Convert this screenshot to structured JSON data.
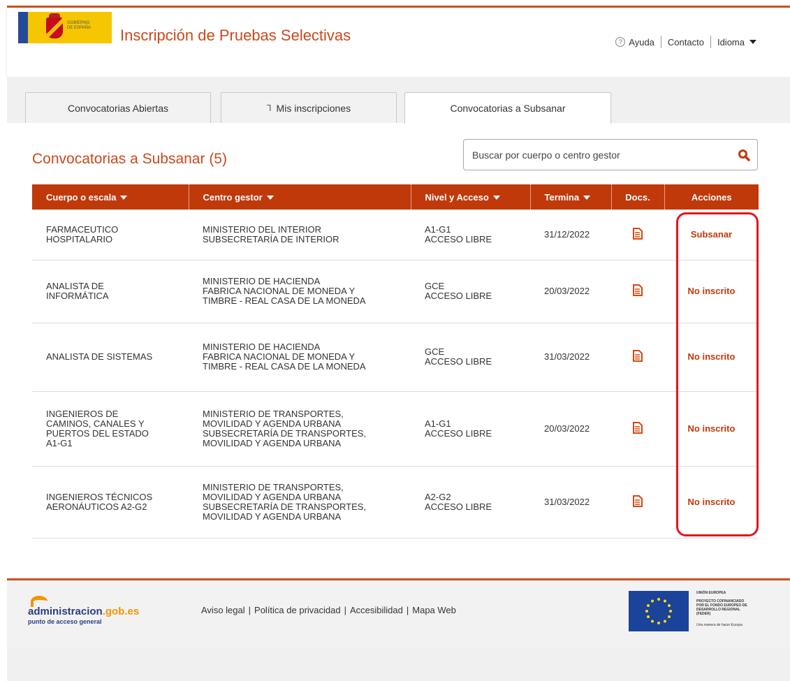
{
  "header": {
    "gov_logo_text": [
      "GOBIERNO",
      "DE ESPAÑA"
    ],
    "title": "Inscripción de Pruebas Selectivas",
    "help": "Ayuda",
    "contact": "Contacto",
    "language": "Idioma"
  },
  "tabs": [
    {
      "label": "Convocatorias Abiertas",
      "active": false
    },
    {
      "label": "Mis inscripciones",
      "active": false,
      "icon": "lock-icon"
    },
    {
      "label": "Convocatorias a Subsanar",
      "active": true
    }
  ],
  "main": {
    "title": "Convocatorias a Subsanar (5)",
    "search_placeholder": "Buscar por cuerpo o centro gestor"
  },
  "table": {
    "headers": {
      "cuerpo": "Cuerpo o escala",
      "centro": "Centro gestor",
      "nivel": "Nivel y Acceso",
      "termina": "Termina",
      "docs": "Docs.",
      "acciones": "Acciones"
    },
    "rows": [
      {
        "cuerpo": [
          "FARMACEUTICO",
          "HOSPITALARIO"
        ],
        "centro": [
          "MINISTERIO DEL INTERIOR",
          "SUBSECRETARÍA DE INTERIOR"
        ],
        "nivel": [
          "A1-G1",
          "ACCESO LIBRE"
        ],
        "termina": "31/12/2022",
        "action": "Subsanar"
      },
      {
        "cuerpo": [
          "ANALISTA DE",
          "INFORMÁTICA"
        ],
        "centro": [
          "MINISTERIO DE HACIENDA",
          "FABRICA NACIONAL DE MONEDA Y",
          "TIMBRE - REAL CASA DE LA MONEDA"
        ],
        "nivel": [
          "GCE",
          "ACCESO LIBRE"
        ],
        "termina": "20/03/2022",
        "action": "No inscrito"
      },
      {
        "cuerpo": [
          "ANALISTA DE SISTEMAS"
        ],
        "centro": [
          "MINISTERIO DE HACIENDA",
          "FABRICA NACIONAL DE MONEDA Y",
          "TIMBRE - REAL CASA DE LA MONEDA"
        ],
        "nivel": [
          "GCE",
          "ACCESO LIBRE"
        ],
        "termina": "31/03/2022",
        "action": "No inscrito"
      },
      {
        "cuerpo": [
          "INGENIEROS DE",
          "CAMINOS, CANALES Y",
          "PUERTOS DEL ESTADO",
          "A1-G1"
        ],
        "centro": [
          "MINISTERIO DE TRANSPORTES,",
          "MOVILIDAD Y AGENDA URBANA",
          "SUBSECRETARÍA DE TRANSPORTES,",
          "MOVILIDAD Y AGENDA URBANA"
        ],
        "nivel": [
          "A1-G1",
          "ACCESO LIBRE"
        ],
        "termina": "20/03/2022",
        "action": "No inscrito"
      },
      {
        "cuerpo": [
          "INGENIEROS TÉCNICOS",
          "AERONÁUTICOS A2-G2"
        ],
        "centro": [
          "MINISTERIO DE TRANSPORTES,",
          "MOVILIDAD Y AGENDA URBANA",
          "SUBSECRETARÍA DE TRANSPORTES,",
          "MOVILIDAD Y AGENDA URBANA"
        ],
        "nivel": [
          "A2-G2",
          "ACCESO LIBRE"
        ],
        "termina": "31/03/2022",
        "action": "No inscrito"
      }
    ]
  },
  "footer": {
    "admin_logo": {
      "main_a": "administracion",
      "main_b": ".gob.es",
      "sub": "punto de acceso general"
    },
    "links": [
      "Aviso legal",
      "Política de privacidad",
      "Accesibilidad",
      "Mapa Web"
    ],
    "eu_text": [
      "UNIÓN EUROPEA",
      "PROYECTO COFINANCIADO",
      "POR EL FONDO EUROPEO DE",
      "DESARROLLO REGIONAL",
      "(FEDER)",
      "Una manera de hacer Europa"
    ]
  },
  "colors": {
    "accent": "#c0390b",
    "title": "#c84a1d",
    "highlight": "#e3161c"
  }
}
